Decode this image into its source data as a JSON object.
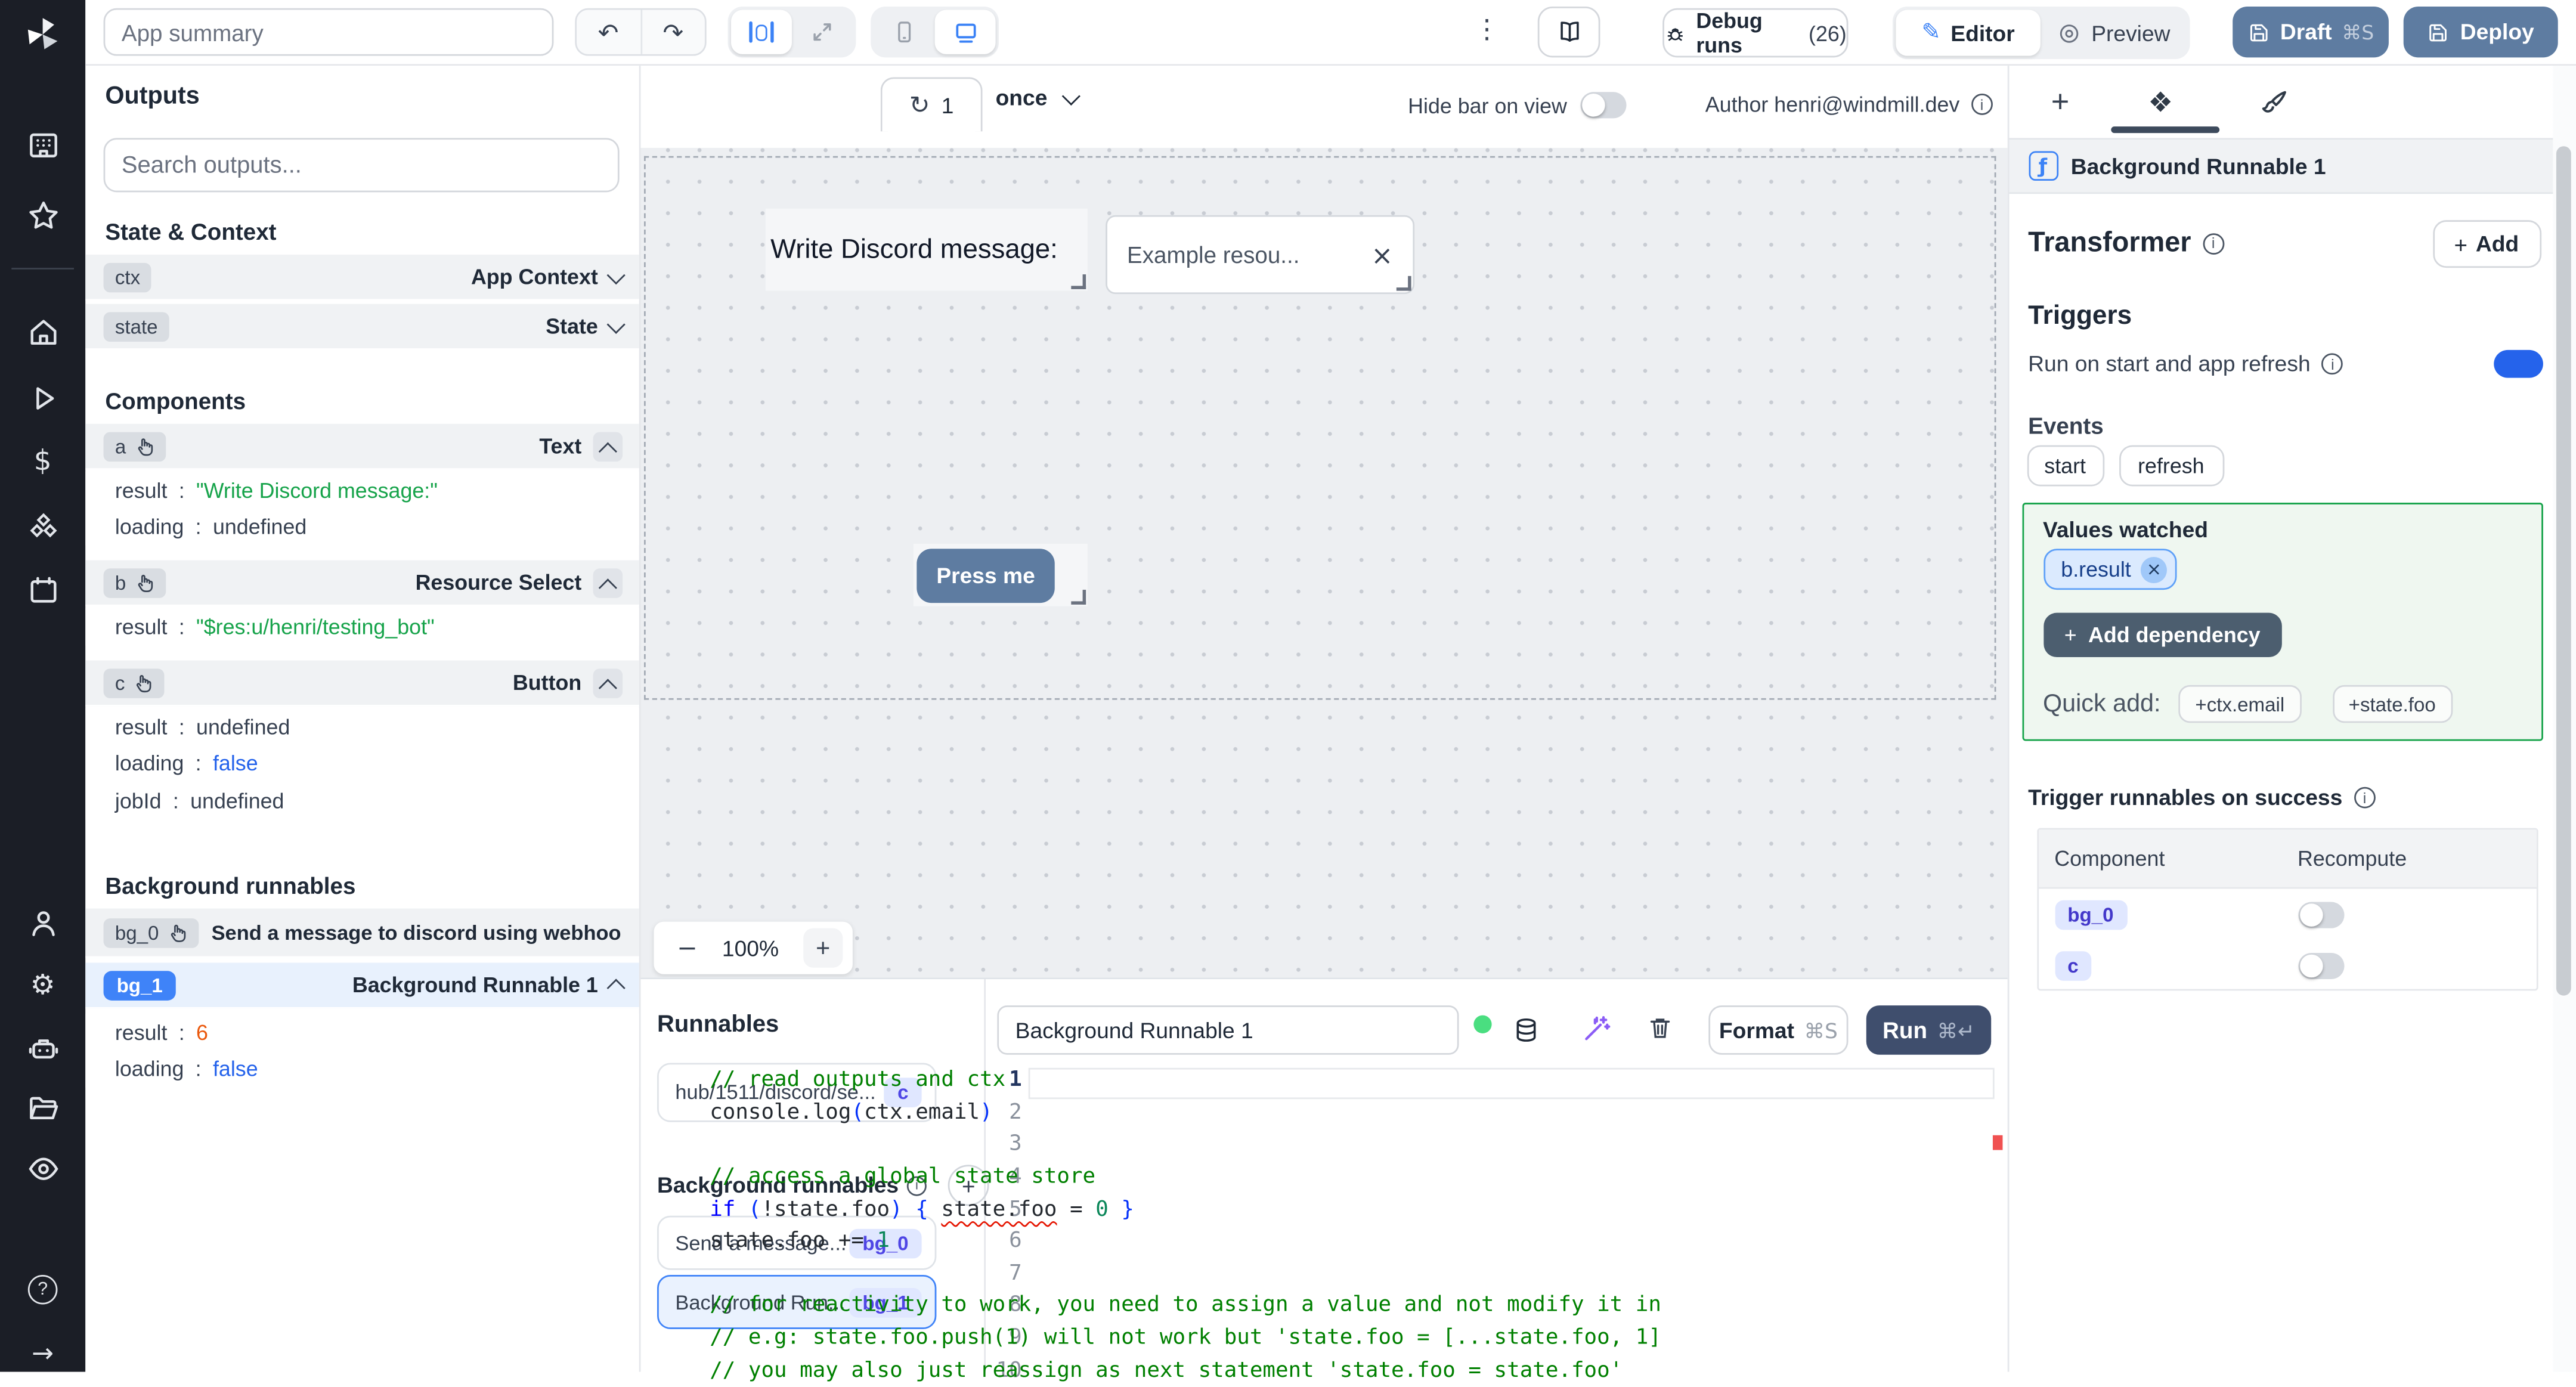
{
  "glyphs": {
    "info": "i",
    "close": "×",
    "plus": "+",
    "minus": "−",
    "kebab": "⋮",
    "undo": "↶",
    "redo": "↷",
    "refresh": "↻",
    "components_tab": "❖",
    "fn": "ƒ",
    "question": "?",
    "arrow_right": "→",
    "dollar": "$",
    "gear": "⚙",
    "pencil": "✎"
  },
  "topbar": {
    "app_summary_placeholder": "App summary",
    "debug_runs_label": "Debug runs",
    "debug_runs_count": "(26)",
    "editor_label": "Editor",
    "preview_label": "Preview",
    "draft_label": "Draft",
    "draft_shortcut": "⌘S",
    "deploy_label": "Deploy"
  },
  "canvas_toolbar": {
    "refresh_count": "1",
    "mode": "once",
    "hide_bar_label": "Hide bar on view",
    "author_label": "Author henri@windmill.dev"
  },
  "canvas": {
    "text_component": "Write Discord message:",
    "select_value": "Example resou...",
    "button_label": "Press me",
    "zoom_value": "100%"
  },
  "outputs": {
    "title": "Outputs",
    "search_placeholder": "Search outputs...",
    "state_context_title": "State & Context",
    "ctx_badge": "ctx",
    "ctx_type": "App Context",
    "state_badge": "state",
    "state_type": "State",
    "components_title": "Components",
    "a_badge": "a",
    "a_type": "Text",
    "a_rows": [
      {
        "k": "result",
        "v": "\"Write Discord message:\"",
        "t": "str"
      },
      {
        "k": "loading",
        "v": "undefined",
        "t": "plain"
      }
    ],
    "b_badge": "b",
    "b_type": "Resource Select",
    "b_rows": [
      {
        "k": "result",
        "v": "\"$res:u/henri/testing_bot\"",
        "t": "str"
      }
    ],
    "c_badge": "c",
    "c_type": "Button",
    "c_rows": [
      {
        "k": "result",
        "v": "undefined",
        "t": "plain"
      },
      {
        "k": "loading",
        "v": "false",
        "t": "bool"
      },
      {
        "k": "jobId",
        "v": "undefined",
        "t": "plain"
      }
    ],
    "background_title": "Background runnables",
    "bg0_badge": "bg_0",
    "bg0_label": "Send a message to discord using webhoo",
    "bg1_badge": "bg_1",
    "bg1_label": "Background Runnable 1",
    "bg1_rows": [
      {
        "k": "result",
        "v": "6",
        "t": "num"
      },
      {
        "k": "loading",
        "v": "false",
        "t": "bool"
      }
    ]
  },
  "runnables_panel": {
    "title": "Runnables",
    "hub_card_label": "hub/1511/discord/se...",
    "hub_card_badge": "c",
    "background_title": "Background runnables",
    "bg0_card_label": "Send a message...",
    "bg0_card_badge": "bg_0",
    "bg1_card_label": "Background Run...",
    "bg1_card_badge": "bg_1"
  },
  "editor": {
    "title": "Background Runnable 1",
    "format_label": "Format",
    "format_shortcut": "⌘S",
    "run_label": "Run",
    "run_shortcut": "⌘↵",
    "lines": [
      [
        {
          "t": "// read outputs and ctx",
          "c": "com"
        }
      ],
      [
        {
          "t": "console.log",
          "c": "def"
        },
        {
          "t": "(",
          "c": "par"
        },
        {
          "t": "ctx.email",
          "c": "def"
        },
        {
          "t": ")",
          "c": "par"
        }
      ],
      [],
      [
        {
          "t": "// access a global state store",
          "c": "com"
        }
      ],
      [
        {
          "t": "if ",
          "c": "kw"
        },
        {
          "t": "(",
          "c": "par"
        },
        {
          "t": "!state.foo",
          "c": "def"
        },
        {
          "t": ") ",
          "c": "par"
        },
        {
          "t": "{ ",
          "c": "par"
        },
        {
          "t": "state.foo",
          "c": "def err"
        },
        {
          "t": " = ",
          "c": "def"
        },
        {
          "t": "0",
          "c": "num"
        },
        {
          "t": " }",
          "c": "par"
        }
      ],
      [
        {
          "t": "state.foo += ",
          "c": "def"
        },
        {
          "t": "1",
          "c": "num"
        }
      ],
      [],
      [
        {
          "t": "// for reactivity to work, you need to assign a value and not modify it in p",
          "c": "com"
        }
      ],
      [
        {
          "t": "// e.g: state.foo.push(1) will not work but 'state.foo = [...state.foo, 1]'",
          "c": "com"
        }
      ],
      [
        {
          "t": "// you may also just reassign as next statement 'state.foo = state.foo'",
          "c": "com"
        }
      ]
    ]
  },
  "right_panel": {
    "header_title": "Background Runnable 1",
    "transformer_label": "Transformer",
    "add_label": "Add",
    "triggers_title": "Triggers",
    "run_on_start_label": "Run on start and app refresh",
    "events_label": "Events",
    "event_chips": [
      "start",
      "refresh"
    ],
    "values_watched_label": "Values watched",
    "watched_chip": "b.result",
    "add_dependency_label": "Add dependency",
    "quick_add_label": "Quick add:",
    "quick_chips": [
      "+ctx.email",
      "+state.foo"
    ],
    "trigger_success_label": "Trigger runnables on success",
    "table_headers": [
      "Component",
      "Recompute"
    ],
    "table_rows": [
      {
        "badge": "bg_0"
      },
      {
        "badge": "c"
      }
    ]
  }
}
